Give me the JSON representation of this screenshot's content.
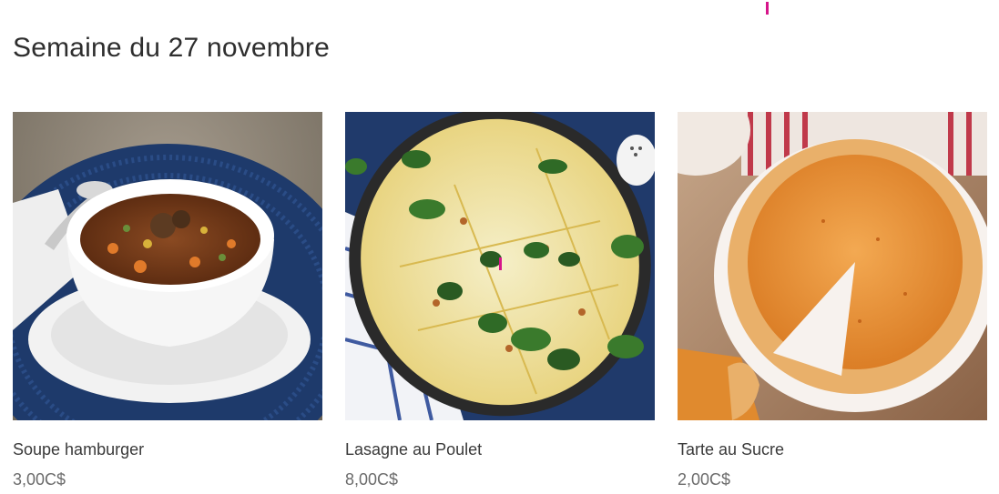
{
  "section": {
    "title": "Semaine du 27 novembre"
  },
  "products": [
    {
      "name": "Soupe hamburger",
      "price": "3,00C$",
      "image_icon": "soup-bowl-image"
    },
    {
      "name": "Lasagne au Poulet",
      "price": "8,00C$",
      "image_icon": "lasagna-dish-image"
    },
    {
      "name": "Tarte au Sucre",
      "price": "2,00C$",
      "image_icon": "sugar-pie-image"
    }
  ],
  "colors": {
    "accent": "#d6158a",
    "text": "#2e2e2e",
    "price": "#6b6b6b"
  }
}
